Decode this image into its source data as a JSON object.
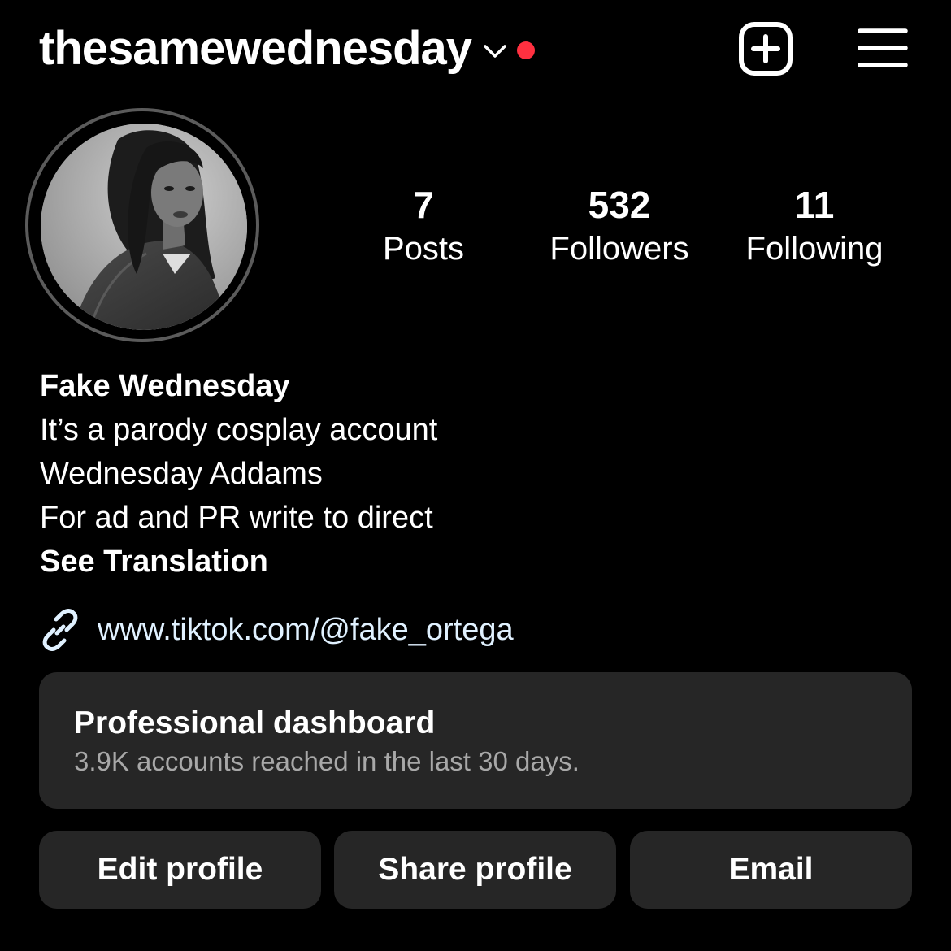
{
  "header": {
    "username": "thesamewednesday",
    "notification_dot_color": "#ff3040",
    "chevron_icon": "chevron-down-icon",
    "new_post_icon": "plus-square-icon",
    "menu_icon": "hamburger-menu-icon"
  },
  "profile": {
    "avatar_alt": "profile picture",
    "stats": [
      {
        "count": "7",
        "label": "Posts"
      },
      {
        "count": "532",
        "label": "Followers"
      },
      {
        "count": "11",
        "label": "Following"
      }
    ]
  },
  "bio": {
    "name": "Fake Wednesday",
    "lines": [
      "It’s a parody cosplay account",
      "Wednesday Addams",
      "For ad and PR write to direct"
    ],
    "see_translation": "See Translation"
  },
  "link": {
    "icon": "link-icon",
    "text": "www.tiktok.com/@fake_ortega"
  },
  "dashboard": {
    "title": "Professional dashboard",
    "subtitle": "3.9K accounts reached in the last 30 days."
  },
  "actions": {
    "edit_profile": "Edit profile",
    "share_profile": "Share profile",
    "email": "Email"
  },
  "colors": {
    "background": "#000000",
    "surface": "#262626",
    "secondary_text": "#a8a8a8",
    "link_text": "#e0f1ff"
  }
}
